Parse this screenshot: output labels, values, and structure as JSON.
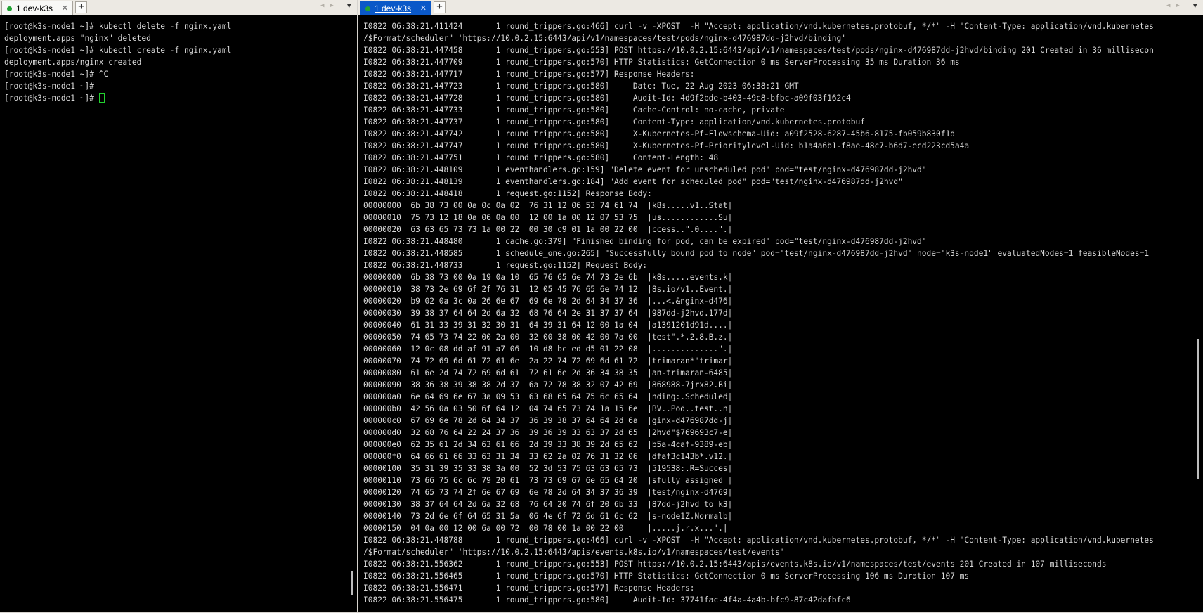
{
  "left_pane": {
    "tab": {
      "label": "1 dev-k3s",
      "close": "✕"
    },
    "new_tab": "+",
    "lines": [
      "[root@k3s-node1 ~]# kubectl delete -f nginx.yaml",
      "deployment.apps \"nginx\" deleted",
      "[root@k3s-node1 ~]# kubectl create -f nginx.yaml",
      "deployment.apps/nginx created",
      "[root@k3s-node1 ~]# ^C",
      "[root@k3s-node1 ~]#",
      "[root@k3s-node1 ~]# "
    ]
  },
  "right_pane": {
    "tab": {
      "label": "1 dev-k3s",
      "close": "✕"
    },
    "new_tab": "+",
    "lines": [
      "I0822 06:38:21.411424       1 round_trippers.go:466] curl -v -XPOST  -H \"Accept: application/vnd.kubernetes.protobuf, */*\" -H \"Content-Type: application/vnd.kubernetes",
      "/$Format/scheduler\" 'https://10.0.2.15:6443/api/v1/namespaces/test/pods/nginx-d476987dd-j2hvd/binding'",
      "I0822 06:38:21.447458       1 round_trippers.go:553] POST https://10.0.2.15:6443/api/v1/namespaces/test/pods/nginx-d476987dd-j2hvd/binding 201 Created in 36 millisecon",
      "I0822 06:38:21.447709       1 round_trippers.go:570] HTTP Statistics: GetConnection 0 ms ServerProcessing 35 ms Duration 36 ms",
      "I0822 06:38:21.447717       1 round_trippers.go:577] Response Headers:",
      "I0822 06:38:21.447723       1 round_trippers.go:580]     Date: Tue, 22 Aug 2023 06:38:21 GMT",
      "I0822 06:38:21.447728       1 round_trippers.go:580]     Audit-Id: 4d9f2bde-b403-49c8-bfbc-a09f03f162c4",
      "I0822 06:38:21.447733       1 round_trippers.go:580]     Cache-Control: no-cache, private",
      "I0822 06:38:21.447737       1 round_trippers.go:580]     Content-Type: application/vnd.kubernetes.protobuf",
      "I0822 06:38:21.447742       1 round_trippers.go:580]     X-Kubernetes-Pf-Flowschema-Uid: a09f2528-6287-45b6-8175-fb059b830f1d",
      "I0822 06:38:21.447747       1 round_trippers.go:580]     X-Kubernetes-Pf-Prioritylevel-Uid: b1a4a6b1-f8ae-48c7-b6d7-ecd223cd5a4a",
      "I0822 06:38:21.447751       1 round_trippers.go:580]     Content-Length: 48",
      "I0822 06:38:21.448109       1 eventhandlers.go:159] \"Delete event for unscheduled pod\" pod=\"test/nginx-d476987dd-j2hvd\"",
      "I0822 06:38:21.448139       1 eventhandlers.go:184] \"Add event for scheduled pod\" pod=\"test/nginx-d476987dd-j2hvd\"",
      "I0822 06:38:21.448418       1 request.go:1152] Response Body:",
      "00000000  6b 38 73 00 0a 0c 0a 02  76 31 12 06 53 74 61 74  |k8s.....v1..Stat|",
      "00000010  75 73 12 18 0a 06 0a 00  12 00 1a 00 12 07 53 75  |us............Su|",
      "00000020  63 63 65 73 73 1a 00 22  00 30 c9 01 1a 00 22 00  |ccess..\".0....\".|",
      "I0822 06:38:21.448480       1 cache.go:379] \"Finished binding for pod, can be expired\" pod=\"test/nginx-d476987dd-j2hvd\"",
      "I0822 06:38:21.448585       1 schedule_one.go:265] \"Successfully bound pod to node\" pod=\"test/nginx-d476987dd-j2hvd\" node=\"k3s-node1\" evaluatedNodes=1 feasibleNodes=1",
      "I0822 06:38:21.448733       1 request.go:1152] Request Body:",
      "00000000  6b 38 73 00 0a 19 0a 10  65 76 65 6e 74 73 2e 6b  |k8s.....events.k|",
      "00000010  38 73 2e 69 6f 2f 76 31  12 05 45 76 65 6e 74 12  |8s.io/v1..Event.|",
      "00000020  b9 02 0a 3c 0a 26 6e 67  69 6e 78 2d 64 34 37 36  |...<.&nginx-d476|",
      "00000030  39 38 37 64 64 2d 6a 32  68 76 64 2e 31 37 37 64  |987dd-j2hvd.177d|",
      "00000040  61 31 33 39 31 32 30 31  64 39 31 64 12 00 1a 04  |a1391201d91d....|",
      "00000050  74 65 73 74 22 00 2a 00  32 00 38 00 42 00 7a 00  |test\".*.2.8.B.z.|",
      "00000060  12 0c 08 dd af 91 a7 06  10 d8 bc ed d5 01 22 08  |..............\".|",
      "00000070  74 72 69 6d 61 72 61 6e  2a 22 74 72 69 6d 61 72  |trimaran*\"trimar|",
      "00000080  61 6e 2d 74 72 69 6d 61  72 61 6e 2d 36 34 38 35  |an-trimaran-6485|",
      "00000090  38 36 38 39 38 38 2d 37  6a 72 78 38 32 07 42 69  |868988-7jrx82.Bi|",
      "000000a0  6e 64 69 6e 67 3a 09 53  63 68 65 64 75 6c 65 64  |nding:.Scheduled|",
      "000000b0  42 56 0a 03 50 6f 64 12  04 74 65 73 74 1a 15 6e  |BV..Pod..test..n|",
      "000000c0  67 69 6e 78 2d 64 34 37  36 39 38 37 64 64 2d 6a  |ginx-d476987dd-j|",
      "000000d0  32 68 76 64 22 24 37 36  39 36 39 33 63 37 2d 65  |2hvd\"$769693c7-e|",
      "000000e0  62 35 61 2d 34 63 61 66  2d 39 33 38 39 2d 65 62  |b5a-4caf-9389-eb|",
      "000000f0  64 66 61 66 33 63 31 34  33 62 2a 02 76 31 32 06  |dfaf3c143b*.v12.|",
      "00000100  35 31 39 35 33 38 3a 00  52 3d 53 75 63 63 65 73  |519538:.R=Succes|",
      "00000110  73 66 75 6c 6c 79 20 61  73 73 69 67 6e 65 64 20  |sfully assigned |",
      "00000120  74 65 73 74 2f 6e 67 69  6e 78 2d 64 34 37 36 39  |test/nginx-d4769|",
      "00000130  38 37 64 64 2d 6a 32 68  76 64 20 74 6f 20 6b 33  |87dd-j2hvd to k3|",
      "00000140  73 2d 6e 6f 64 65 31 5a  06 4e 6f 72 6d 61 6c 62  |s-node1Z.Normalb|",
      "00000150  04 0a 00 12 00 6a 00 72  00 78 00 1a 00 22 00     |.....j.r.x...\".|",
      "I0822 06:38:21.448788       1 round_trippers.go:466] curl -v -XPOST  -H \"Accept: application/vnd.kubernetes.protobuf, */*\" -H \"Content-Type: application/vnd.kubernetes",
      "/$Format/scheduler\" 'https://10.0.2.15:6443/apis/events.k8s.io/v1/namespaces/test/events'",
      "I0822 06:38:21.556362       1 round_trippers.go:553] POST https://10.0.2.15:6443/apis/events.k8s.io/v1/namespaces/test/events 201 Created in 107 milliseconds",
      "I0822 06:38:21.556465       1 round_trippers.go:570] HTTP Statistics: GetConnection 0 ms ServerProcessing 106 ms Duration 107 ms",
      "I0822 06:38:21.556471       1 round_trippers.go:577] Response Headers:",
      "I0822 06:38:21.556475       1 round_trippers.go:580]     Audit-Id: 37741fac-4f4a-4a4b-bfc9-87c42dafbfc6"
    ]
  },
  "colors": {
    "terminal_bg": "#000000",
    "terminal_fg": "#d8d8d8",
    "cursor": "#22d12e",
    "active_tab": "#0a58c8",
    "tab_dot": "#22a334"
  }
}
